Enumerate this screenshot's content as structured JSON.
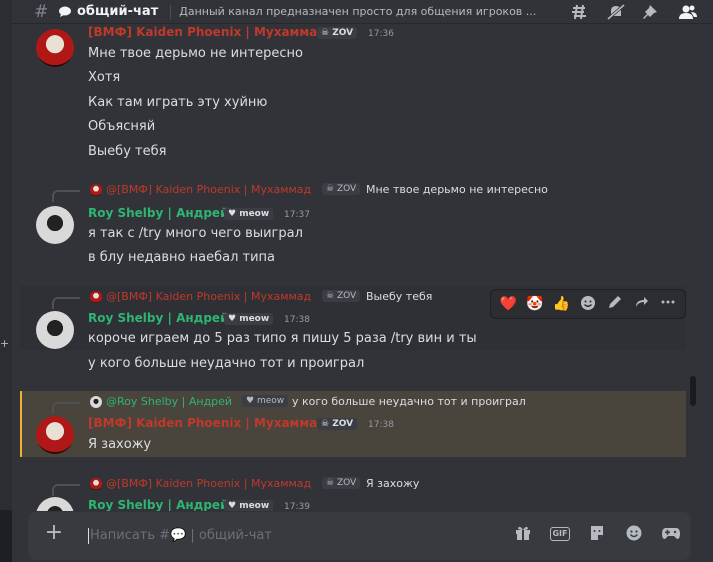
{
  "header": {
    "channel_name": "общий-чат",
    "topic": "Данный канал предназначен просто для общения игроков ..."
  },
  "messages_group1": {
    "author": "[ВМФ] Kaiden Phoenix | Мухаммад",
    "tag": "ZOV",
    "time": "17:36",
    "lines": [
      "Мне твое дерьмо не интересно",
      "Хотя",
      "Как там играть эту хуйню",
      "Объясняй",
      "Выебу тебя"
    ]
  },
  "reply1": {
    "author": "@[ВМФ] Kaiden Phoenix | Мухаммад",
    "tag": "ZOV",
    "text": "Мне твое дерьмо не интересно"
  },
  "messages_group2": {
    "author": "Roy Shelby | Андрей",
    "tag": "meow",
    "time": "17:37",
    "lines": [
      "я так с /try много чего выиграл",
      "в блу недавно наебал типа"
    ]
  },
  "reply2": {
    "author": "@[ВМФ] Kaiden Phoenix | Мухаммад",
    "tag": "ZOV",
    "text": "Выебу тебя"
  },
  "messages_group3": {
    "author": "Roy Shelby | Андрей",
    "tag": "meow",
    "time": "17:38",
    "lines": [
      "короче играем до 5 раз типо я пишу 5 раза /try вин и ты",
      "у кого больше неудачно тот и проиграл"
    ]
  },
  "reply3": {
    "author": "@Roy Shelby | Андрей",
    "tag": "meow",
    "text": "у кого больше неудачно тот и проиграл"
  },
  "messages_group4": {
    "author": "[ВМФ] Kaiden Phoenix | Мухаммад",
    "tag": "ZOV",
    "time": "17:38",
    "lines": [
      "Я захожу"
    ]
  },
  "reply4": {
    "author": "@[ВМФ] Kaiden Phoenix | Мухаммад",
    "tag": "ZOV",
    "text": "Я захожу"
  },
  "messages_group5": {
    "author": "Roy Shelby | Андрей",
    "tag": "meow",
    "time": "17:39"
  },
  "reactions": [
    "❤️",
    "🤡",
    "👍"
  ],
  "composer": {
    "placeholder": "Написать #💬 | общий-чат"
  },
  "colors": {
    "phoenix": "#c0392b",
    "roy": "#2fb573",
    "mention_bar": "#f0b232"
  },
  "icons": [
    "threads-icon",
    "mute-icon",
    "pin-icon",
    "members-icon",
    "gift-icon",
    "gif-icon",
    "sticker-icon",
    "emoji-icon",
    "activity-icon"
  ]
}
